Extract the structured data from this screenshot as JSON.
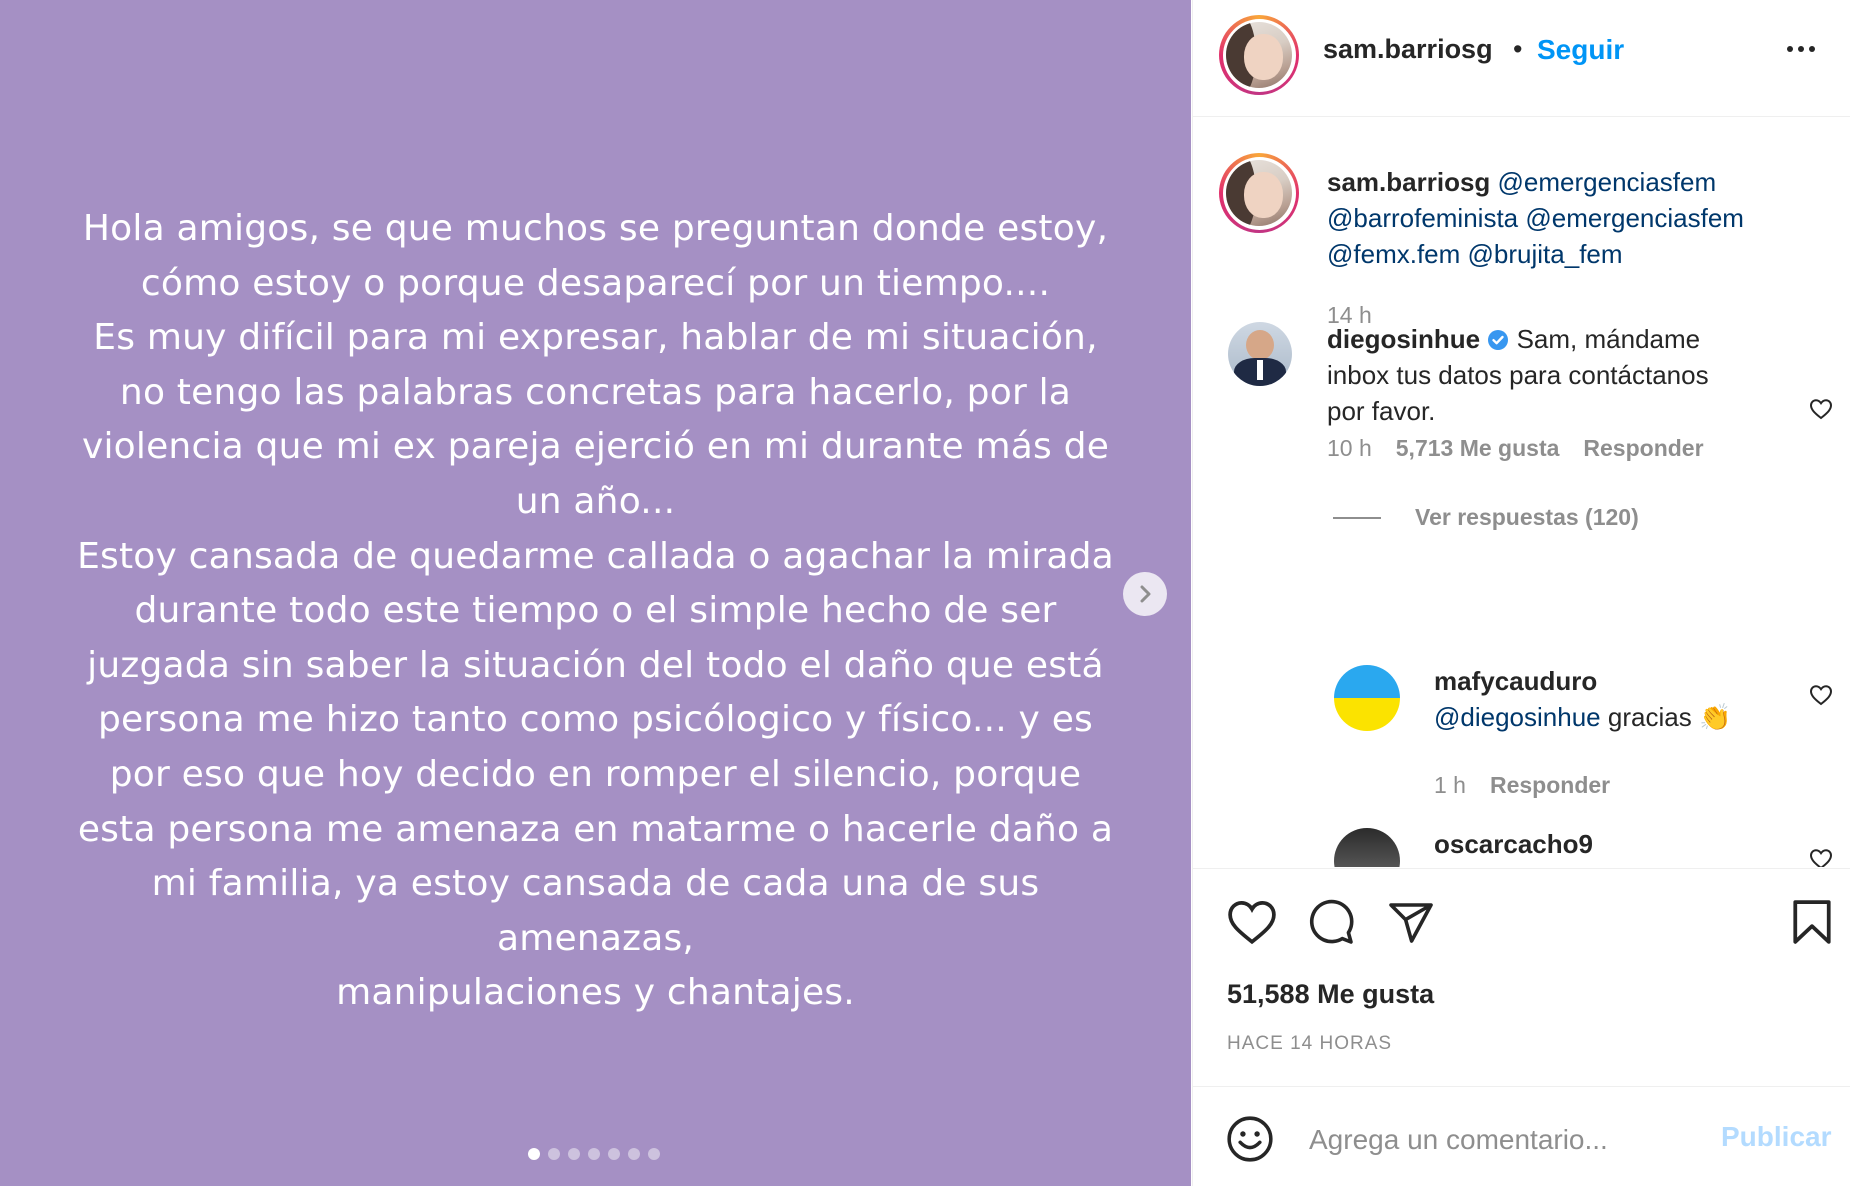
{
  "post": {
    "text_lines": [
      "Hola amigos, se que muchos se preguntan donde estoy,",
      "cómo estoy o porque desaparecí por un tiempo....",
      "Es muy difícil para mi expresar, hablar de mi situación,",
      "no tengo las palabras concretas para hacerlo, por la",
      "violencia que mi ex pareja ejerció en mi durante más de",
      "un año...",
      "Estoy cansada de quedarme callada o agachar la mirada",
      "durante todo este tiempo o el simple hecho de ser",
      "juzgada sin saber la situación del todo el daño que está",
      "persona me hizo tanto como psicólogico y físico... y es",
      "por eso que hoy decido en romper el silencio, porque",
      "esta persona me amenaza en matarme o hacerle daño a",
      "mi familia, ya estoy cansada de cada una de sus",
      "amenazas,",
      "manipulaciones y chantajes."
    ],
    "background_color": "#a590c4",
    "carousel_count": 7,
    "carousel_active": 1,
    "next_icon": "chevron-right-icon"
  },
  "header": {
    "username": "sam.barriosg",
    "separator": "•",
    "follow_label": "Seguir",
    "more_icon": "more-horizontal-icon"
  },
  "caption": {
    "username": "sam.barriosg",
    "mentions_line1": "@emergenciasfem",
    "mentions_line2": "@barrofeminista @emergenciasfem",
    "mentions_line3": "@femx.fem @brujita_fem",
    "time": "14 h"
  },
  "comments": [
    {
      "username": "diegosinhue",
      "verified": true,
      "text_line1": "Sam, mándame",
      "text_line2": "inbox tus datos para contáctanos",
      "text_line3": "por favor.",
      "time": "10 h",
      "likes": "5,713 Me gusta",
      "reply_label": "Responder",
      "view_replies": "Ver respuestas (120)",
      "replies": [
        {
          "username": "mafycauduro",
          "mention": "@diegosinhue",
          "text": "gracias",
          "emoji": "👏",
          "time": "1 h",
          "reply_label": "Responder"
        },
        {
          "username": "oscarcacho9"
        }
      ]
    }
  ],
  "actions": {
    "like_icon": "heart-icon",
    "comment_icon": "comment-icon",
    "share_icon": "send-icon",
    "save_icon": "bookmark-icon",
    "likes": "51,588 Me gusta",
    "time_caps": "HACE 14 HORAS"
  },
  "add_comment": {
    "emoji_icon": "smiley-icon",
    "placeholder": "Agrega un comentario...",
    "publish_label": "Publicar"
  },
  "colors": {
    "accent": "#0095f6",
    "publish_disabled": "#b3dbff",
    "text": "#262626",
    "muted": "#8e8e8e",
    "mention": "#00376b",
    "verified": "#3897f0"
  }
}
